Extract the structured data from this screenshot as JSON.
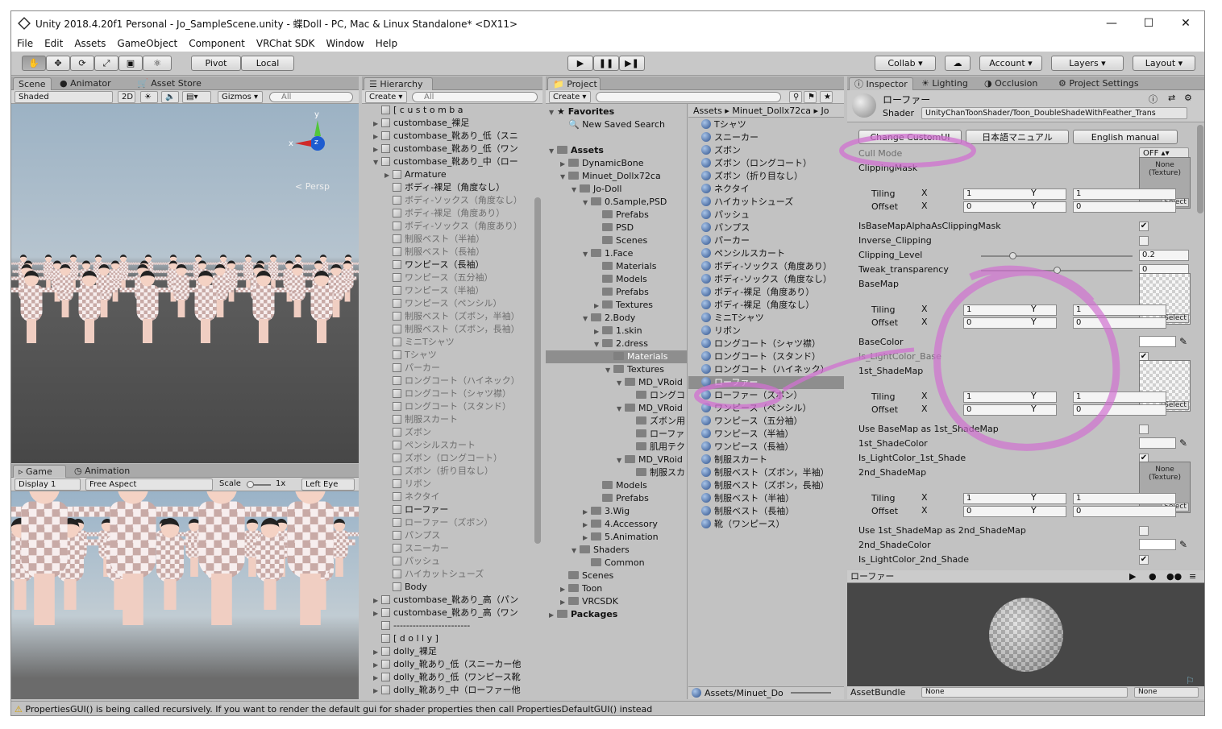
{
  "window": {
    "title": "Unity 2018.4.20f1 Personal - Jo_SampleScene.unity - 蝶Doll - PC, Mac & Linux Standalone* <DX11>"
  },
  "menu": [
    "File",
    "Edit",
    "Assets",
    "GameObject",
    "Component",
    "VRChat SDK",
    "Window",
    "Help"
  ],
  "toolbar": {
    "pivot": "Pivot",
    "local": "Local",
    "collab": "Collab ▾",
    "account": "Account",
    "layers": "Layers",
    "layout": "Layout"
  },
  "scene": {
    "tabs": [
      "Scene",
      "Animator",
      "Asset Store"
    ],
    "shading": "Shaded",
    "mode2d": "2D",
    "gizmos": "Gizmos",
    "search": "All",
    "persp": "Persp",
    "axes": {
      "x": "x",
      "y": "y",
      "z": "z"
    }
  },
  "game": {
    "tabs": [
      "Game",
      "Animation"
    ],
    "display": "Display 1",
    "aspect": "Free Aspect",
    "scale_label": "Scale",
    "scale_value": "1x",
    "eye": "Left Eye"
  },
  "hierarchy": {
    "tab": "Hierarchy",
    "create": "Create",
    "search": "All",
    "items": [
      {
        "text": "[ c u s t o m   b a",
        "ind": 0,
        "g": 0,
        "f": ""
      },
      {
        "text": "custombase_裸足",
        "ind": 0,
        "g": 0,
        "f": "▶"
      },
      {
        "text": "custombase_靴あり_低（スニ",
        "ind": 0,
        "g": 0,
        "f": "▶"
      },
      {
        "text": "custombase_靴あり_低（ワン",
        "ind": 0,
        "g": 0,
        "f": "▶"
      },
      {
        "text": "custombase_靴あり_中（ロー",
        "ind": 0,
        "g": 0,
        "f": "▼"
      },
      {
        "text": "Armature",
        "ind": 1,
        "g": 0,
        "f": "▶"
      },
      {
        "text": "ボディ-裸足（角度なし）",
        "ind": 1,
        "g": 0,
        "f": ""
      },
      {
        "text": "ボディ-ソックス（角度なし）",
        "ind": 1,
        "g": 1,
        "f": ""
      },
      {
        "text": "ボディ-裸足（角度あり）",
        "ind": 1,
        "g": 1,
        "f": ""
      },
      {
        "text": "ボディ-ソックス（角度あり）",
        "ind": 1,
        "g": 1,
        "f": ""
      },
      {
        "text": "制服ベスト（半袖）",
        "ind": 1,
        "g": 1,
        "f": ""
      },
      {
        "text": "制服ベスト（長袖）",
        "ind": 1,
        "g": 1,
        "f": ""
      },
      {
        "text": "ワンピース（長袖）",
        "ind": 1,
        "g": 0,
        "f": ""
      },
      {
        "text": "ワンピース（五分袖）",
        "ind": 1,
        "g": 1,
        "f": ""
      },
      {
        "text": "ワンピース（半袖）",
        "ind": 1,
        "g": 1,
        "f": ""
      },
      {
        "text": "ワンピース（ペンシル）",
        "ind": 1,
        "g": 1,
        "f": ""
      },
      {
        "text": "制服ベスト（ズボン，半袖）",
        "ind": 1,
        "g": 1,
        "f": ""
      },
      {
        "text": "制服ベスト（ズボン，長袖）",
        "ind": 1,
        "g": 1,
        "f": ""
      },
      {
        "text": "ミニTシャツ",
        "ind": 1,
        "g": 1,
        "f": ""
      },
      {
        "text": "Tシャツ",
        "ind": 1,
        "g": 1,
        "f": ""
      },
      {
        "text": "パーカー",
        "ind": 1,
        "g": 1,
        "f": ""
      },
      {
        "text": "ロングコート（ハイネック）",
        "ind": 1,
        "g": 1,
        "f": ""
      },
      {
        "text": "ロングコート（シャツ襟）",
        "ind": 1,
        "g": 1,
        "f": ""
      },
      {
        "text": "ロングコート（スタンド）",
        "ind": 1,
        "g": 1,
        "f": ""
      },
      {
        "text": "制服スカート",
        "ind": 1,
        "g": 1,
        "f": ""
      },
      {
        "text": "ズボン",
        "ind": 1,
        "g": 1,
        "f": ""
      },
      {
        "text": "ペンシルスカート",
        "ind": 1,
        "g": 1,
        "f": ""
      },
      {
        "text": "ズボン（ロングコート）",
        "ind": 1,
        "g": 1,
        "f": ""
      },
      {
        "text": "ズボン（折り目なし）",
        "ind": 1,
        "g": 1,
        "f": ""
      },
      {
        "text": "リボン",
        "ind": 1,
        "g": 1,
        "f": ""
      },
      {
        "text": "ネクタイ",
        "ind": 1,
        "g": 1,
        "f": ""
      },
      {
        "text": "ローファー",
        "ind": 1,
        "g": 0,
        "f": ""
      },
      {
        "text": "ローファー（ズボン）",
        "ind": 1,
        "g": 1,
        "f": ""
      },
      {
        "text": "パンプス",
        "ind": 1,
        "g": 1,
        "f": ""
      },
      {
        "text": "スニーカー",
        "ind": 1,
        "g": 1,
        "f": ""
      },
      {
        "text": "パッシュ",
        "ind": 1,
        "g": 1,
        "f": ""
      },
      {
        "text": "ハイカットシューズ",
        "ind": 1,
        "g": 1,
        "f": ""
      },
      {
        "text": "Body",
        "ind": 1,
        "g": 0,
        "f": ""
      },
      {
        "text": "custombase_靴あり_高（パン",
        "ind": 0,
        "g": 0,
        "f": "▶"
      },
      {
        "text": "custombase_靴あり_高（ワン",
        "ind": 0,
        "g": 0,
        "f": "▶"
      },
      {
        "text": "------------------------",
        "ind": 0,
        "g": 0,
        "f": ""
      },
      {
        "text": "[ d o l l y ]",
        "ind": 0,
        "g": 0,
        "f": ""
      },
      {
        "text": "dolly_裸足",
        "ind": 0,
        "g": 0,
        "f": "▶"
      },
      {
        "text": "dolly_靴あり_低（スニーカー他",
        "ind": 0,
        "g": 0,
        "f": "▶"
      },
      {
        "text": "dolly_靴あり_低（ワンピース靴",
        "ind": 0,
        "g": 0,
        "f": "▶"
      },
      {
        "text": "dolly_靴あり_中（ローファー他",
        "ind": 0,
        "g": 0,
        "f": "▶"
      }
    ]
  },
  "project": {
    "tab": "Project",
    "create": "Create",
    "favorites": "Favorites",
    "saved_search": "New Saved Search",
    "tree": [
      {
        "text": "Assets",
        "ind": 0,
        "b": 1,
        "f": "▼"
      },
      {
        "text": "DynamicBone",
        "ind": 1,
        "b": 0,
        "f": "▶"
      },
      {
        "text": "Minuet_Dollx72ca",
        "ind": 1,
        "b": 0,
        "f": "▼"
      },
      {
        "text": "Jo-Doll",
        "ind": 2,
        "b": 0,
        "f": "▼"
      },
      {
        "text": "0.Sample,PSD",
        "ind": 3,
        "b": 0,
        "f": "▼"
      },
      {
        "text": "Prefabs",
        "ind": 4,
        "b": 0,
        "f": ""
      },
      {
        "text": "PSD",
        "ind": 4,
        "b": 0,
        "f": ""
      },
      {
        "text": "Scenes",
        "ind": 4,
        "b": 0,
        "f": ""
      },
      {
        "text": "1.Face",
        "ind": 3,
        "b": 0,
        "f": "▼"
      },
      {
        "text": "Materials",
        "ind": 4,
        "b": 0,
        "f": ""
      },
      {
        "text": "Models",
        "ind": 4,
        "b": 0,
        "f": ""
      },
      {
        "text": "Prefabs",
        "ind": 4,
        "b": 0,
        "f": ""
      },
      {
        "text": "Textures",
        "ind": 4,
        "b": 0,
        "f": "▶"
      },
      {
        "text": "2.Body",
        "ind": 3,
        "b": 0,
        "f": "▼"
      },
      {
        "text": "1.skin",
        "ind": 4,
        "b": 0,
        "f": "▶"
      },
      {
        "text": "2.dress",
        "ind": 4,
        "b": 0,
        "f": "▼"
      },
      {
        "text": "Materials",
        "ind": 5,
        "b": 0,
        "f": "",
        "s": 1
      },
      {
        "text": "Textures",
        "ind": 5,
        "b": 0,
        "f": "▼"
      },
      {
        "text": "MD_VRoid",
        "ind": 6,
        "b": 0,
        "f": "▼"
      },
      {
        "text": "ロングコ",
        "ind": 7,
        "b": 0,
        "f": ""
      },
      {
        "text": "MD_VRoid",
        "ind": 6,
        "b": 0,
        "f": "▼"
      },
      {
        "text": "ズボン用",
        "ind": 7,
        "b": 0,
        "f": ""
      },
      {
        "text": "ローファ",
        "ind": 7,
        "b": 0,
        "f": ""
      },
      {
        "text": "肌用テク",
        "ind": 7,
        "b": 0,
        "f": ""
      },
      {
        "text": "MD_VRoid",
        "ind": 6,
        "b": 0,
        "f": "▼"
      },
      {
        "text": "制服スカ",
        "ind": 7,
        "b": 0,
        "f": ""
      },
      {
        "text": "Models",
        "ind": 4,
        "b": 0,
        "f": ""
      },
      {
        "text": "Prefabs",
        "ind": 4,
        "b": 0,
        "f": ""
      },
      {
        "text": "3.Wig",
        "ind": 3,
        "b": 0,
        "f": "▶"
      },
      {
        "text": "4.Accessory",
        "ind": 3,
        "b": 0,
        "f": "▶"
      },
      {
        "text": "5.Animation",
        "ind": 3,
        "b": 0,
        "f": "▶"
      },
      {
        "text": "Shaders",
        "ind": 2,
        "b": 0,
        "f": "▼"
      },
      {
        "text": "Common",
        "ind": 3,
        "b": 0,
        "f": ""
      },
      {
        "text": "Scenes",
        "ind": 1,
        "b": 0,
        "f": ""
      },
      {
        "text": "Toon",
        "ind": 1,
        "b": 0,
        "f": "▶"
      },
      {
        "text": "VRCSDK",
        "ind": 1,
        "b": 0,
        "f": "▶"
      },
      {
        "text": "Packages",
        "ind": 0,
        "b": 1,
        "f": "▶"
      }
    ],
    "breadcrumb": [
      "Assets",
      "Minuet_Dollx72ca",
      "Jo"
    ],
    "assets": [
      {
        "t": "Tシャツ"
      },
      {
        "t": "スニーカー"
      },
      {
        "t": "ズボン"
      },
      {
        "t": "ズボン（ロングコート）"
      },
      {
        "t": "ズボン（折り目なし）"
      },
      {
        "t": "ネクタイ"
      },
      {
        "t": "ハイカットシューズ"
      },
      {
        "t": "パッシュ"
      },
      {
        "t": "パンプス"
      },
      {
        "t": "パーカー"
      },
      {
        "t": "ペンシルスカート"
      },
      {
        "t": "ボディ-ソックス（角度あり）"
      },
      {
        "t": "ボディ-ソックス（角度なし）"
      },
      {
        "t": "ボディ-裸足（角度あり）"
      },
      {
        "t": "ボディ-裸足（角度なし）"
      },
      {
        "t": "ミニTシャツ"
      },
      {
        "t": "リボン"
      },
      {
        "t": "ロングコート（シャツ襟）"
      },
      {
        "t": "ロングコート（スタンド）"
      },
      {
        "t": "ロングコート（ハイネック）"
      },
      {
        "t": "ローファー",
        "s": 1
      },
      {
        "t": "ローファー（ズボン）"
      },
      {
        "t": "ワンピース（ペンシル）"
      },
      {
        "t": "ワンピース（五分袖）"
      },
      {
        "t": "ワンピース（半袖）"
      },
      {
        "t": "ワンピース（長袖）"
      },
      {
        "t": "制服スカート"
      },
      {
        "t": "制服ベスト（ズボン，半袖）"
      },
      {
        "t": "制服ベスト（ズボン，長袖）"
      },
      {
        "t": "制服ベスト（半袖）"
      },
      {
        "t": "制服ベスト（長袖）"
      },
      {
        "t": "靴（ワンピース）"
      }
    ],
    "footer_path": "Assets/Minuet_Do"
  },
  "inspector": {
    "tabs": [
      "Inspector",
      "Lighting",
      "Occlusion",
      "Project Settings"
    ],
    "material_name": "ローファー",
    "shader_label": "Shader",
    "shader_value": "UnityChanToonShader/Toon_DoubleShadeWithFeather_Trans",
    "buttons": [
      "Change CustomUI",
      "日本語マニュアル",
      "English manual"
    ],
    "cull_label": "Cull Mode",
    "cull_value": "OFF",
    "clipping_mask": "ClippingMask",
    "tiling": "Tiling",
    "offset": "Offset",
    "x": "X",
    "y": "Y",
    "one": "1",
    "zero": "0",
    "none_tex": "None\n(Texture)",
    "select": "Select",
    "is_base_alpha": "IsBaseMapAlphaAsClippingMask",
    "inverse_clipping": "Inverse_Clipping",
    "clipping_level": "Clipping_Level",
    "clipping_level_value": "0.2",
    "tweak": "Tweak_transparency",
    "tweak_value": "0",
    "basemap": "BaseMap",
    "basecolor": "BaseColor",
    "is_light_base": "Is_LightColor_Base",
    "shademap1": "1st_ShadeMap",
    "use_base_as_1st": "Use BaseMap as 1st_ShadeMap",
    "shadecolor1": "1st_ShadeColor",
    "is_light_1st": "Is_LightColor_1st_Shade",
    "shademap2": "2nd_ShadeMap",
    "use_1st_as_2nd": "Use 1st_ShadeMap as 2nd_ShadeMap",
    "shadecolor2": "2nd_ShadeColor",
    "is_light_2nd": "Is_LightColor_2nd_Shade",
    "preview_title": "ローファー",
    "assetbundle_label": "AssetBundle",
    "assetbundle_value": "None",
    "assetbundle_variant": "None"
  },
  "status": {
    "message": "PropertiesGUI() is being called recursively. If you want to render the default gui for shader properties then call PropertiesDefaultGUI() instead"
  },
  "colors": {
    "annotation": "#d070d0",
    "selected": "#8e8e8e"
  }
}
